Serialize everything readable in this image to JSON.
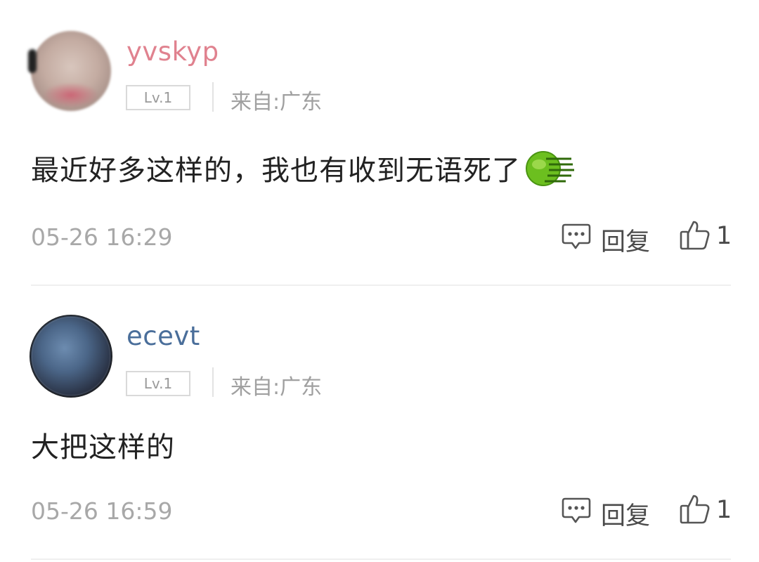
{
  "comments": [
    {
      "username": "yvskyp",
      "username_color": "#e0828f",
      "level": "Lv.1",
      "location": "来自:广东",
      "content": "最近好多这样的，我也有收到无语死了",
      "emoji": "green-fast-emoji-icon",
      "time": "05-26 16:29",
      "reply_label": "回复",
      "like_count": "1"
    },
    {
      "username": "ecevt",
      "username_color": "#4a6e9a",
      "level": "Lv.1",
      "location": "来自:广东",
      "content": "大把这样的",
      "time": "05-26 16:59",
      "reply_label": "回复",
      "like_count": "1"
    }
  ]
}
